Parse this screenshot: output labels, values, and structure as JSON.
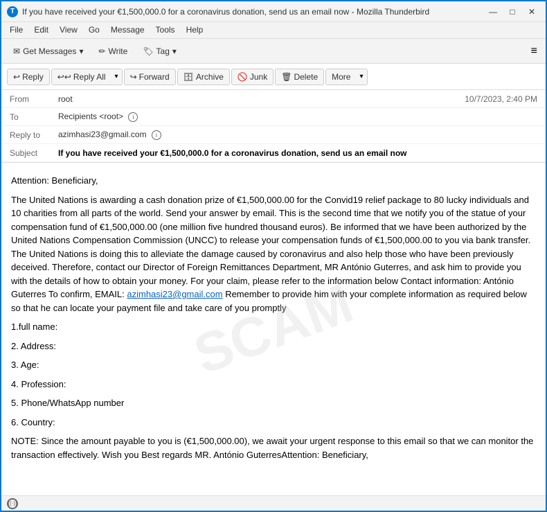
{
  "window": {
    "title": "If you have received your €1,500,000.0 for a coronavirus donation, send us an email now - Mozilla Thunderbird",
    "icon_label": "T"
  },
  "menu": {
    "items": [
      "File",
      "Edit",
      "View",
      "Go",
      "Message",
      "Tools",
      "Help"
    ]
  },
  "toolbar": {
    "get_messages_label": "Get Messages",
    "write_label": "Write",
    "tag_label": "Tag",
    "hamburger": "≡"
  },
  "actions": {
    "reply_label": "Reply",
    "reply_all_label": "Reply All",
    "forward_label": "Forward",
    "archive_label": "Archive",
    "junk_label": "Junk",
    "delete_label": "Delete",
    "more_label": "More"
  },
  "email": {
    "from_label": "From",
    "from_value": "root",
    "to_label": "To",
    "to_value": "Recipients <root>",
    "reply_to_label": "Reply to",
    "reply_to_value": "azimhasi23@gmail.com",
    "subject_label": "Subject",
    "subject_value": "If you have received your €1,500,000.0 for a coronavirus donation, send us an email now",
    "date": "10/7/2023, 2:40 PM",
    "body_text": "Attention: Beneficiary,\n\nThe United Nations is awarding a cash donation prize of €1,500,000.00 for the Convid19 relief package to 80 lucky individuals and 10 charities from all parts of the world. Send your answer by email. This is the second time that we notify you of the statue of your compensation fund of €1,500,000.00 (one million five hundred thousand euros). Be informed that we have been authorized by the United Nations Compensation Commission (UNCC) to release your compensation funds of €1,500,000.00 to you via bank transfer. The United Nations is doing this to alleviate the damage caused by coronavirus and also help those who have been previously deceived. Therefore, contact our Director of Foreign Remittances Department, MR António Guterres, and ask him to provide you with the details of how to obtain your money. For your claim, please refer to the information below Contact information: António Guterres To confirm, EMAIL:",
    "email_link": "azimhasi23@gmail.com",
    "body_text2": "Remember to provide him with your complete information as required below so that he can locate your payment file and take care of you promptly",
    "list": [
      "1.full name:",
      "2. Address:",
      "3. Age:",
      "4. Profession:",
      "5. Phone/WhatsApp number",
      "6. Country:"
    ],
    "note": "NOTE: Since the amount payable to you is (€1,500,000.00), we await your urgent response to this email so that we can monitor the transaction effectively. Wish you Best regards MR. António GuterresAttention: Beneficiary,"
  },
  "statusbar": {
    "icon_label": "wifi",
    "text": ""
  }
}
